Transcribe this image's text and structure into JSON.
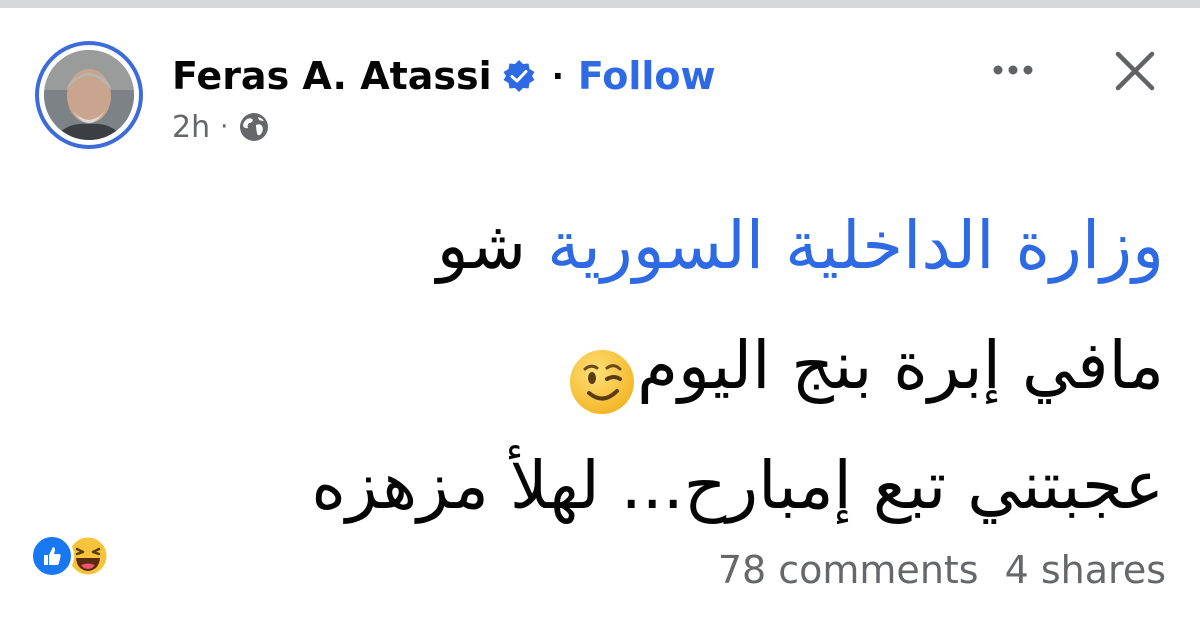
{
  "post": {
    "author": {
      "name": "Feras A. Atassi",
      "verified": true,
      "follow_label": "Follow"
    },
    "meta": {
      "time": "2h",
      "audience_icon": "globe-icon"
    },
    "header_actions": {
      "more_icon": "more-horizontal-icon",
      "close_icon": "close-icon"
    },
    "text": {
      "line1_mention": "وزارة الداخلية السورية",
      "line1_rest": "شو",
      "line2": "مافي إبرة بنج اليوم",
      "line2_emoji": "winking-face-icon",
      "line3": "عجبتني تبع إمبارح... لهلأ مزهزه"
    },
    "reactions": [
      "like-icon",
      "haha-icon"
    ],
    "stats": {
      "comments": "78 comments",
      "shares": "4 shares"
    }
  },
  "colors": {
    "link_blue": "#2d6ae3",
    "text_primary": "#050505",
    "text_secondary": "#65676b",
    "avatar_ring": "#3d6bd9"
  }
}
